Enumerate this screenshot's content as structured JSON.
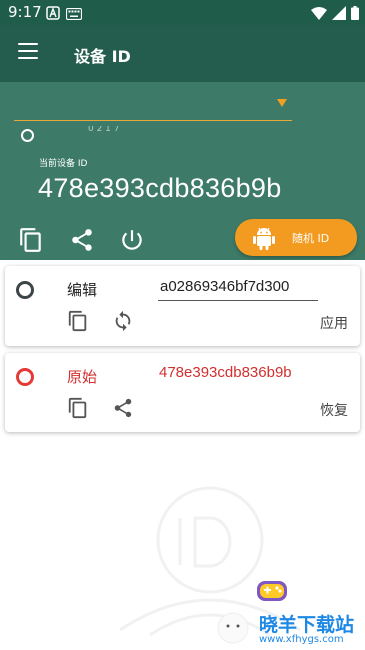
{
  "status_bar": {
    "time": "9:17",
    "left_icons": [
      "notification-a-icon",
      "keyboard-icon"
    ],
    "right_icons": [
      "wifi-icon",
      "cell-signal-icon",
      "battery-icon"
    ]
  },
  "app_bar": {
    "title": "设备 ID",
    "menu_icon": "hamburger-menu-icon"
  },
  "header": {
    "faded_text": "  0 2 1 7",
    "current_label": "当前设备 ID",
    "current_id": "478e393cdb836b9b",
    "actions": [
      "copy-icon",
      "share-icon",
      "power-icon"
    ],
    "random_button_label": "随机 ID"
  },
  "cards": {
    "edit": {
      "label": "编辑",
      "value": "a02869346bf7d300",
      "action_label": "应用",
      "icons": [
        "copy-icon",
        "refresh-icon"
      ]
    },
    "original": {
      "label": "原始",
      "value": "478e393cdb836b9b",
      "action_label": "恢复",
      "icons": [
        "copy-icon",
        "share-icon"
      ]
    }
  },
  "watermark": {
    "name": "晓羊下载站",
    "url": "www.xfhygs.com"
  },
  "colors": {
    "app_bar": "#245d4d",
    "header": "#3d7a67",
    "accent": "#f39b20",
    "original_red": "#d32f2f"
  }
}
